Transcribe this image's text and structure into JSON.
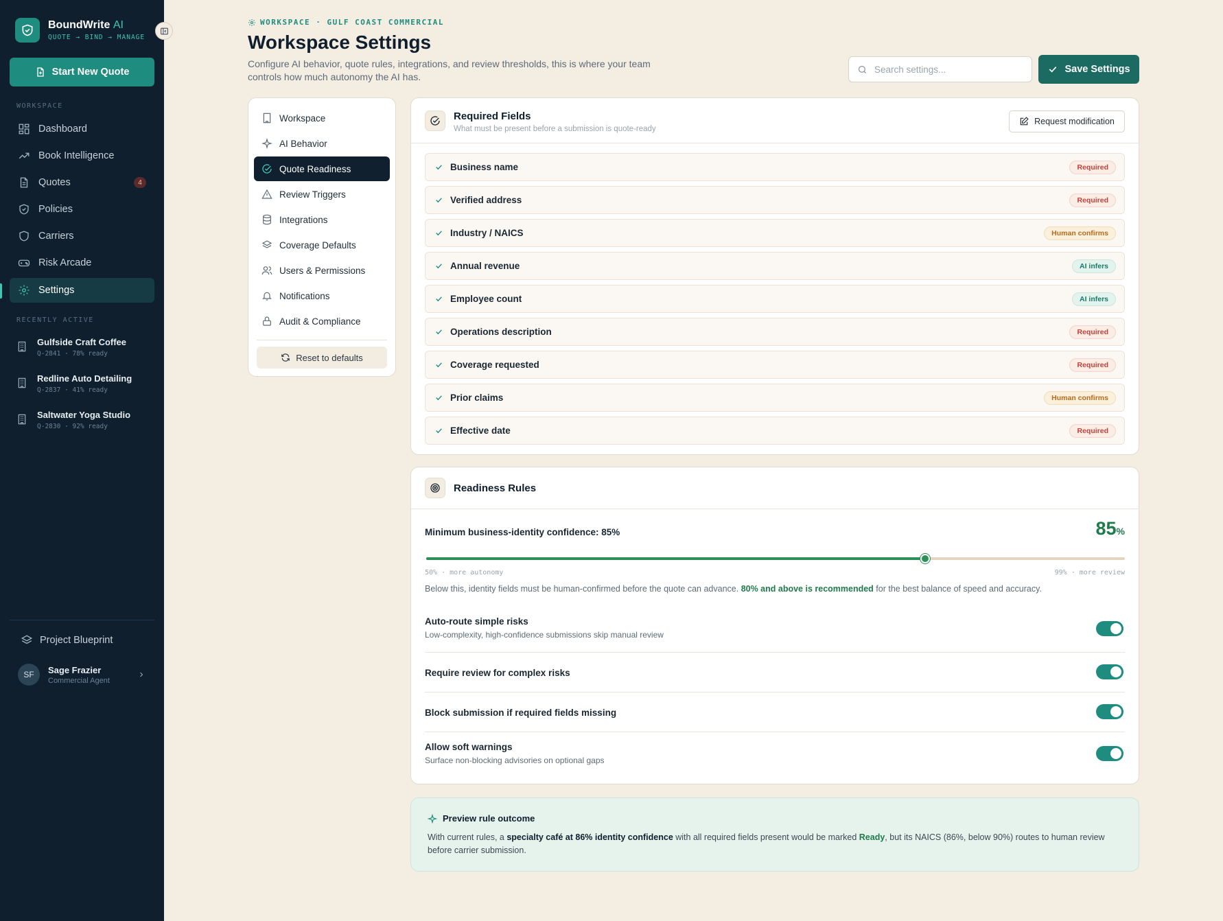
{
  "brand": {
    "name": "BoundWrite",
    "ai": "AI",
    "tagline": "QUOTE → BIND → MANAGE"
  },
  "sidebar": {
    "new_quote_label": "Start New Quote",
    "workspace_label": "WORKSPACE",
    "items": [
      {
        "label": "Dashboard",
        "icon": "dashboard-icon"
      },
      {
        "label": "Book Intelligence",
        "icon": "trend-icon"
      },
      {
        "label": "Quotes",
        "icon": "document-icon",
        "badge": "4"
      },
      {
        "label": "Policies",
        "icon": "shield-icon"
      },
      {
        "label": "Carriers",
        "icon": "shield-outline-icon"
      },
      {
        "label": "Risk Arcade",
        "icon": "gamepad-icon"
      },
      {
        "label": "Settings",
        "icon": "gear-icon",
        "active": true
      }
    ],
    "recent_label": "RECENTLY ACTIVE",
    "recent": [
      {
        "name": "Gulfside Craft Coffee",
        "meta": "Q-2841 · 78% ready"
      },
      {
        "name": "Redline Auto Detailing",
        "meta": "Q-2837 · 41% ready"
      },
      {
        "name": "Saltwater Yoga Studio",
        "meta": "Q-2830 · 92% ready"
      }
    ],
    "blueprint_label": "Project Blueprint",
    "user": {
      "initials": "SF",
      "name": "Sage Frazier",
      "role": "Commercial Agent"
    }
  },
  "header": {
    "breadcrumb": "WORKSPACE · GULF COAST COMMERCIAL",
    "title": "Workspace Settings",
    "description": "Configure AI behavior, quote rules, integrations, and review thresholds, this is where your team controls how much autonomy the AI has.",
    "search_placeholder": "Search settings...",
    "save_label": "Save Settings"
  },
  "settings_nav": {
    "items": [
      {
        "label": "Workspace",
        "icon": "building-icon"
      },
      {
        "label": "AI Behavior",
        "icon": "sparkle-icon"
      },
      {
        "label": "Quote Readiness",
        "icon": "check-circle-icon",
        "active": true
      },
      {
        "label": "Review Triggers",
        "icon": "warning-icon"
      },
      {
        "label": "Integrations",
        "icon": "database-icon"
      },
      {
        "label": "Coverage Defaults",
        "icon": "layers-icon"
      },
      {
        "label": "Users & Permissions",
        "icon": "users-icon"
      },
      {
        "label": "Notifications",
        "icon": "bell-icon"
      },
      {
        "label": "Audit & Compliance",
        "icon": "lock-icon"
      }
    ],
    "reset_label": "Reset to defaults"
  },
  "required_fields": {
    "title": "Required Fields",
    "subtitle": "What must be present before a submission is quote-ready",
    "request_label": "Request modification",
    "fields": [
      {
        "name": "Business name",
        "status": "Required",
        "kind": "req"
      },
      {
        "name": "Verified address",
        "status": "Required",
        "kind": "req"
      },
      {
        "name": "Industry / NAICS",
        "status": "Human confirms",
        "kind": "human"
      },
      {
        "name": "Annual revenue",
        "status": "AI infers",
        "kind": "ai"
      },
      {
        "name": "Employee count",
        "status": "AI infers",
        "kind": "ai"
      },
      {
        "name": "Operations description",
        "status": "Required",
        "kind": "req"
      },
      {
        "name": "Coverage requested",
        "status": "Required",
        "kind": "req"
      },
      {
        "name": "Prior claims",
        "status": "Human confirms",
        "kind": "human"
      },
      {
        "name": "Effective date",
        "status": "Required",
        "kind": "req"
      }
    ]
  },
  "readiness": {
    "title": "Readiness Rules",
    "min_label": "Minimum business-identity confidence: 85%",
    "value": "85",
    "value_unit": "%",
    "slider": {
      "min": 50,
      "max": 99,
      "value": 85
    },
    "range_low": "50% · more autonomy",
    "range_high": "99% · more review",
    "note_before": "Below this, identity fields must be human-confirmed before the quote can advance. ",
    "note_highlight": "80% and above is recommended",
    "note_after": " for the best balance of speed and accuracy.",
    "toggles": [
      {
        "title": "Auto-route simple risks",
        "subtitle": "Low-complexity, high-confidence submissions skip manual review",
        "on": true
      },
      {
        "title": "Require review for complex risks",
        "subtitle": "",
        "on": true
      },
      {
        "title": "Block submission if required fields missing",
        "subtitle": "",
        "on": true
      },
      {
        "title": "Allow soft warnings",
        "subtitle": "Surface non-blocking advisories on optional gaps",
        "on": true
      }
    ]
  },
  "preview": {
    "title": "Preview rule outcome",
    "t1": "With current rules, a ",
    "t2": "specialty café at 86% identity confidence",
    "t3": " with all required fields present would be marked ",
    "t4": "Ready",
    "t5": ", but its NAICS (86%, below 90%) routes to human review before carrier submission."
  },
  "colors": {
    "accent": "#1e8c7e",
    "sidebar_bg": "#0f1f2e",
    "page_bg": "#f4ede2",
    "success": "#1f7a4c"
  }
}
